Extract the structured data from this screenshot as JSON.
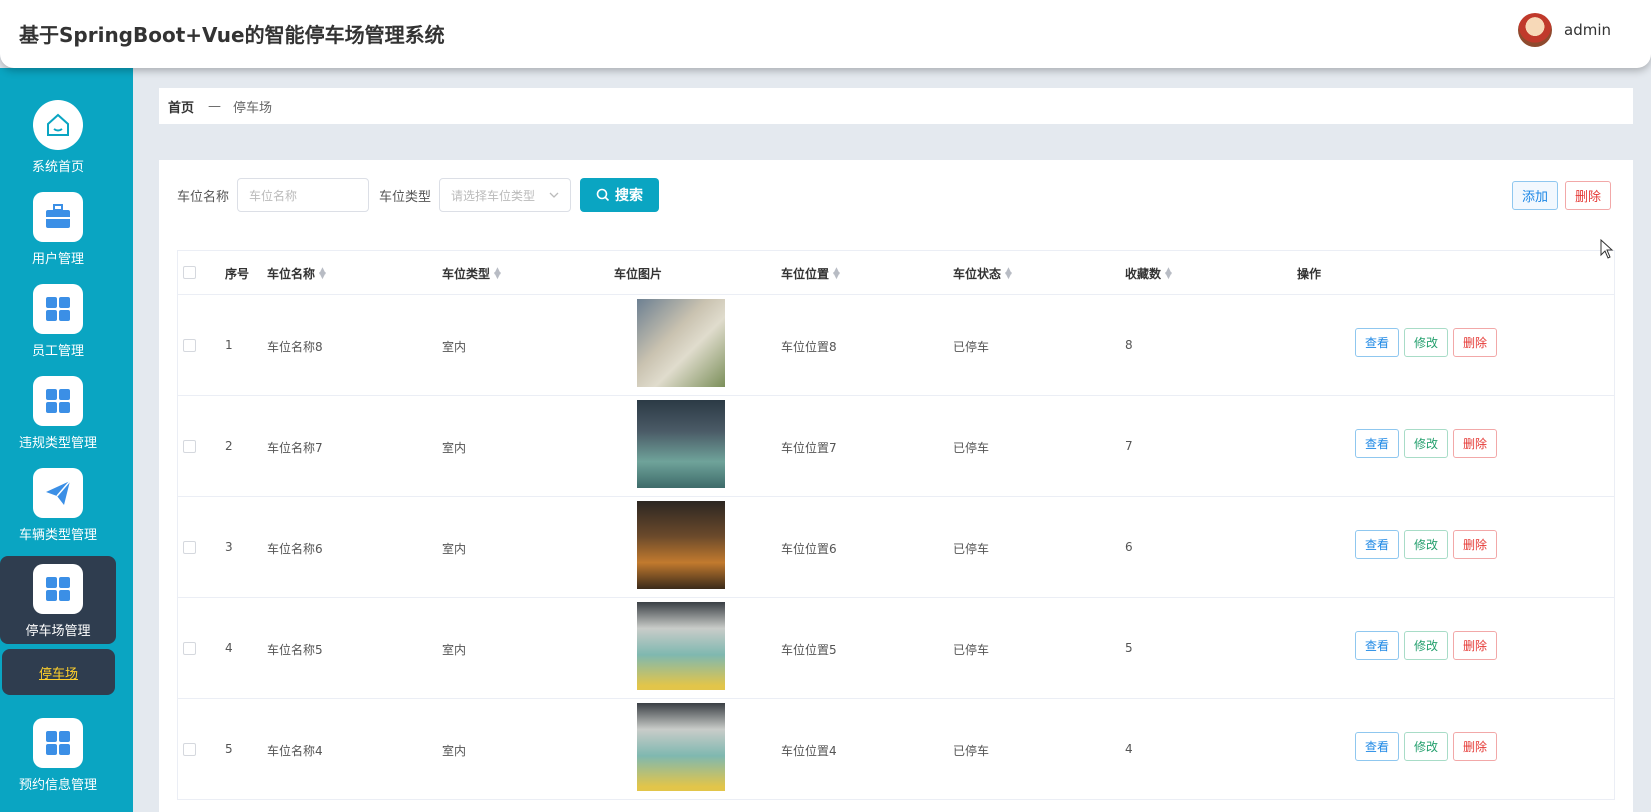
{
  "header": {
    "title": "基于SpringBoot+Vue的智能停车场管理系统",
    "user": "admin"
  },
  "sidebar": {
    "items": [
      {
        "label": "系统首页",
        "icon": "home-icon"
      },
      {
        "label": "用户管理",
        "icon": "briefcase-icon"
      },
      {
        "label": "员工管理",
        "icon": "grid-icon"
      },
      {
        "label": "违规类型管理",
        "icon": "grid-icon"
      },
      {
        "label": "车辆类型管理",
        "icon": "paper-plane-icon"
      },
      {
        "label": "停车场管理",
        "icon": "grid-icon"
      },
      {
        "label": "预约信息管理",
        "icon": "grid-icon"
      }
    ],
    "active_sub": "停车场"
  },
  "breadcrumb": {
    "home": "首页",
    "separator": "—",
    "current": "停车场"
  },
  "search": {
    "name_label": "车位名称",
    "name_placeholder": "车位名称",
    "type_label": "车位类型",
    "type_placeholder": "请选择车位类型",
    "button": "搜索"
  },
  "actions": {
    "add": "添加",
    "delete": "删除"
  },
  "table": {
    "columns": [
      "序号",
      "车位名称",
      "车位类型",
      "车位图片",
      "车位位置",
      "车位状态",
      "收藏数",
      "操作"
    ],
    "rows": [
      {
        "index": "1",
        "name": "车位名称8",
        "type": "室内",
        "location": "车位位置8",
        "status": "已停车",
        "favorites": "8"
      },
      {
        "index": "2",
        "name": "车位名称7",
        "type": "室内",
        "location": "车位位置7",
        "status": "已停车",
        "favorites": "7"
      },
      {
        "index": "3",
        "name": "车位名称6",
        "type": "室内",
        "location": "车位位置6",
        "status": "已停车",
        "favorites": "6"
      },
      {
        "index": "4",
        "name": "车位名称5",
        "type": "室内",
        "location": "车位位置5",
        "status": "已停车",
        "favorites": "5"
      },
      {
        "index": "5",
        "name": "车位名称4",
        "type": "室内",
        "location": "车位位置4",
        "status": "已停车",
        "favorites": "4"
      }
    ],
    "row_actions": {
      "view": "查看",
      "edit": "修改",
      "delete": "删除"
    }
  },
  "colors": {
    "accent": "#0aa5c2",
    "sidebar_active": "#2f3d4f",
    "sub_active_text": "#ffd02b"
  }
}
